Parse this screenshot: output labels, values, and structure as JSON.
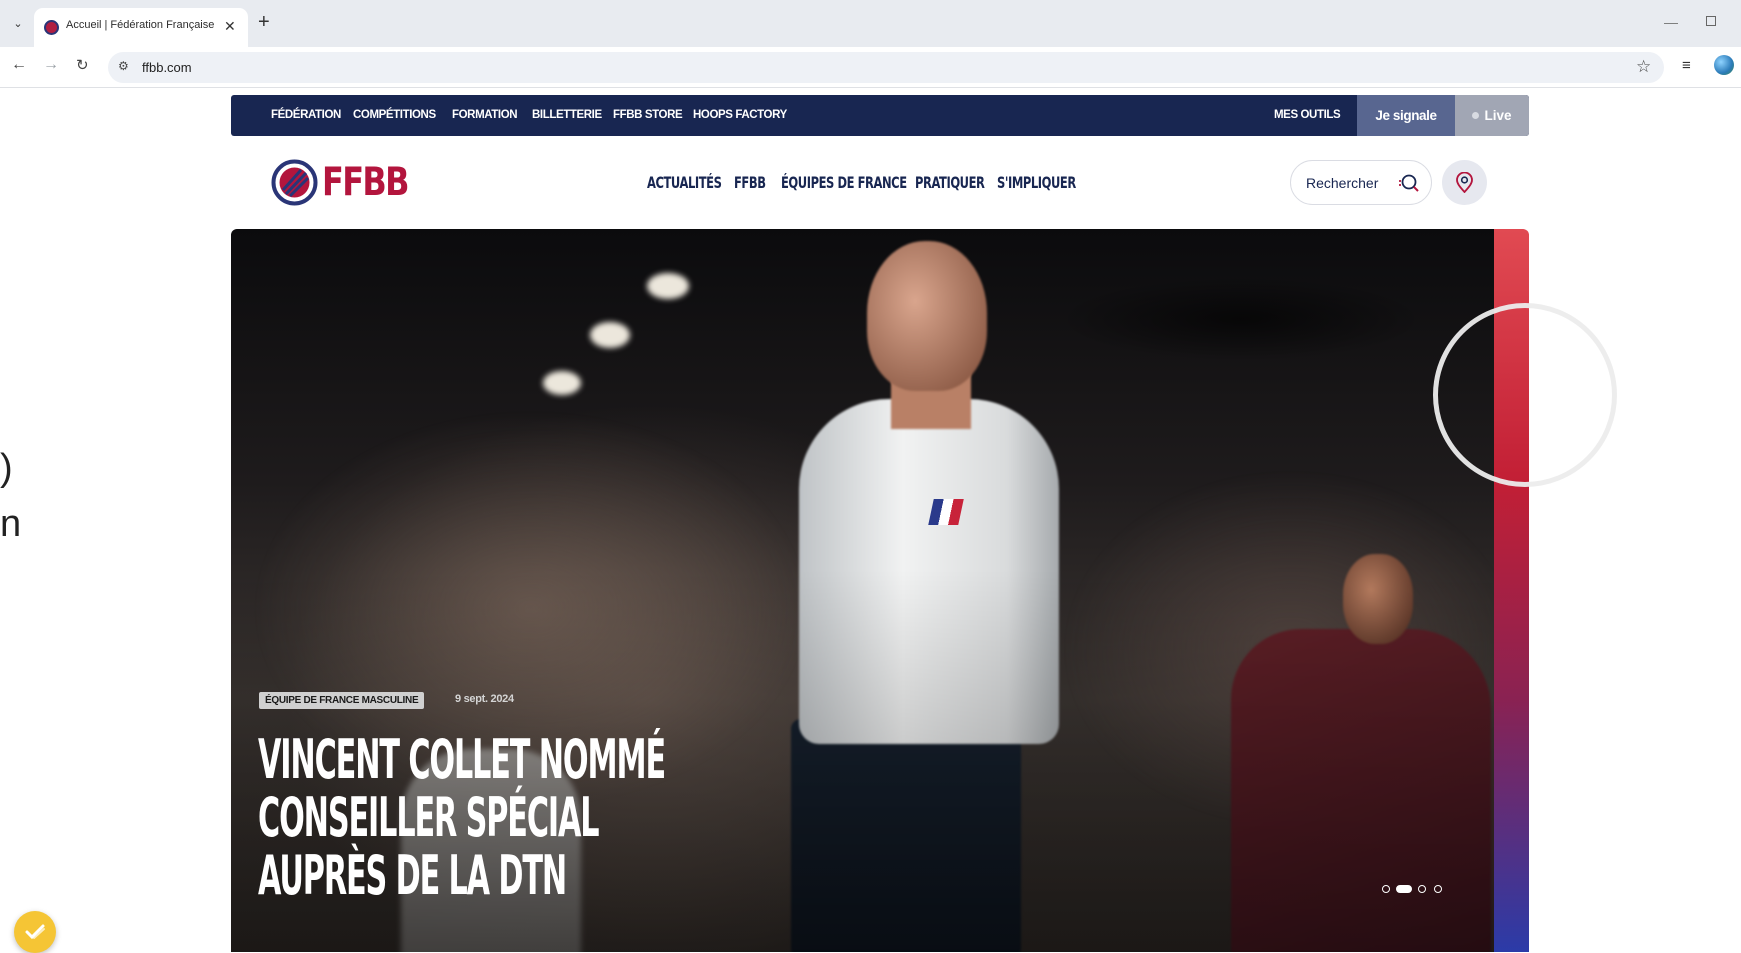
{
  "browser": {
    "tab_title": "Accueil | Fédération Française d",
    "url": "ffbb.com",
    "new_tab_symbol": "+",
    "close_symbol": "✕",
    "icons": [
      "tab-list-icon",
      "favicon-icon",
      "back-icon",
      "forward-icon",
      "reload-icon",
      "site-settings-icon",
      "bookmark-star-icon",
      "reading-list-icon",
      "profile-icon",
      "minimize-icon",
      "maximize-icon"
    ]
  },
  "page_fragment": {
    "line1": ")",
    "line2": "n"
  },
  "topbar": {
    "links": [
      "FÉDÉRATION",
      "COMPÉTITIONS",
      "FORMATION",
      "BILLETTERIE",
      "FFBB STORE",
      "HOOPS FACTORY"
    ],
    "tools": "MES OUTILS",
    "signale": "Je signale",
    "live": "Live",
    "colors": {
      "bar": "#182651",
      "signale_bg": "#586690",
      "live_bg": "#a1a6b4"
    }
  },
  "header": {
    "logo_text": "FFBB",
    "nav": [
      "ACTUALITÉS",
      "FFBB",
      "ÉQUIPES DE FRANCE",
      "PRATIQUER",
      "S'IMPLIQUER"
    ],
    "search_label": "Rechercher",
    "colors": {
      "brand_red": "#b3153d",
      "brand_navy": "#182651"
    }
  },
  "hero": {
    "category": "ÉQUIPE DE FRANCE MASCULINE",
    "date": "9 sept. 2024",
    "title": "VINCENT COLLET NOMMÉ CONSEILLER SPÉCIAL AUPRÈS DE LA DTN",
    "slides_total": 4,
    "active_slide": 2
  }
}
